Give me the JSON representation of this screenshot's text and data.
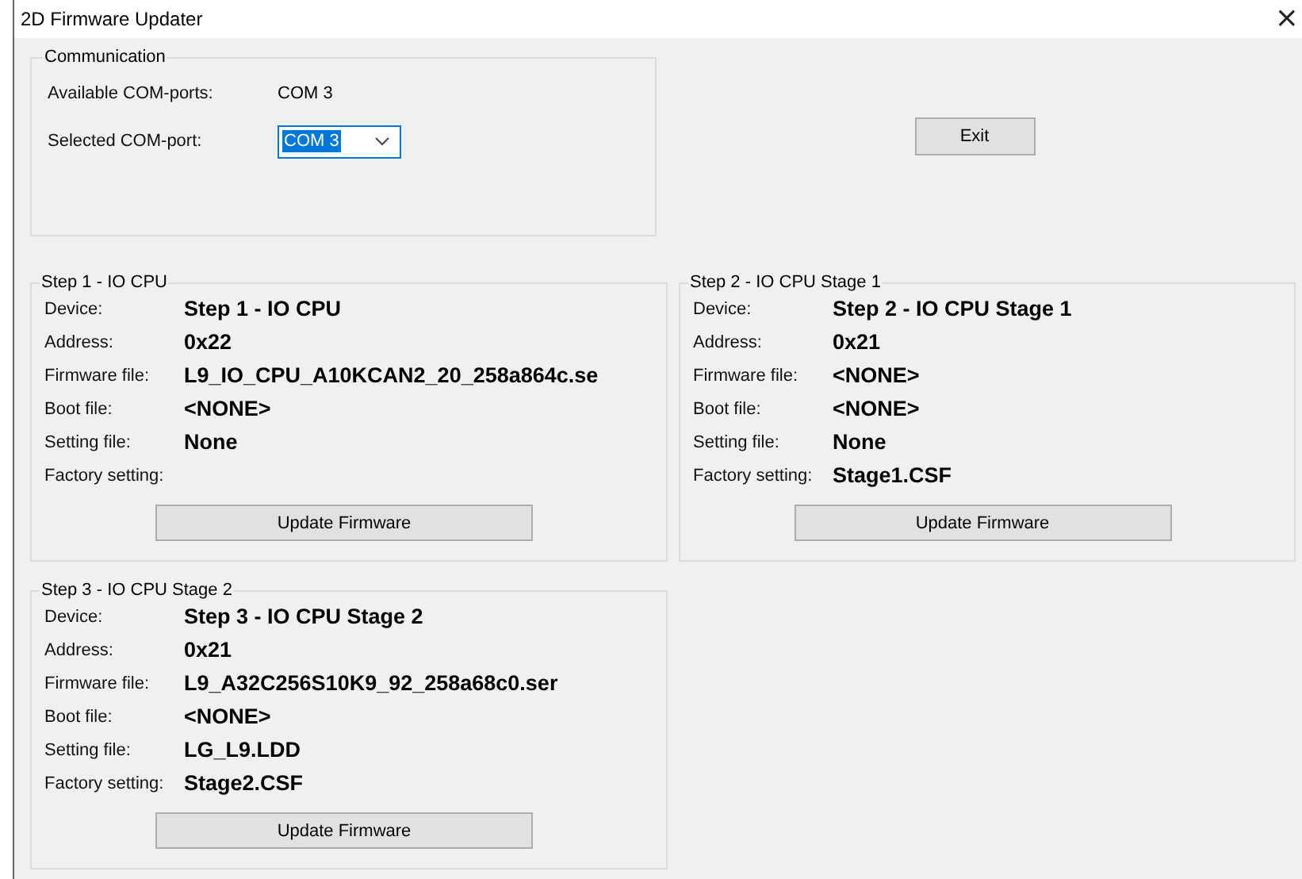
{
  "window": {
    "title": "2D Firmware Updater",
    "close": "×"
  },
  "communication": {
    "title": "Communication",
    "available_label": "Available COM-ports:",
    "available_value": "COM 3",
    "selected_label": "Selected COM-port:",
    "selected_value": "COM 3",
    "selected_text_highlighted": true
  },
  "exit_button": "Exit",
  "steps": [
    {
      "title": "Step 1 - IO CPU",
      "fields": [
        {
          "label": "Device:",
          "value": "Step 1 - IO CPU"
        },
        {
          "label": "Address:",
          "value": "0x22"
        },
        {
          "label": "Firmware file:",
          "value": "L9_IO_CPU_A10KCAN2_20_258a864c.se"
        },
        {
          "label": "Boot file:",
          "value": "<NONE>"
        },
        {
          "label": "Setting file:",
          "value": "None"
        },
        {
          "label": "Factory setting:"
        }
      ],
      "button": "Update Firmware"
    },
    {
      "title": "Step 2 - IO CPU Stage 1",
      "fields": [
        {
          "label": "Device:",
          "value": "Step 2 - IO CPU Stage 1"
        },
        {
          "label": "Address:",
          "value": "0x21"
        },
        {
          "label": "Firmware file:",
          "value": "<NONE>"
        },
        {
          "label": "Boot file:",
          "value": "<NONE>"
        },
        {
          "label": "Setting file:",
          "value": "None"
        },
        {
          "label": "Factory setting:",
          "value": "Stage1.CSF"
        }
      ],
      "button": "Update Firmware"
    },
    {
      "title": "Step 3 - IO CPU Stage 2",
      "fields": [
        {
          "label": "Device:",
          "value": "Step 3 - IO CPU Stage 2"
        },
        {
          "label": "Address:",
          "value": "0x21"
        },
        {
          "label": "Firmware file:",
          "value": "L9_A32C256S10K9_92_258a68c0.ser"
        },
        {
          "label": "Boot file:",
          "value": "<NONE>"
        },
        {
          "label": "Setting file:",
          "value": "LG_L9.LDD"
        },
        {
          "label": "Factory setting:",
          "value": "Stage2.CSF"
        }
      ],
      "button": "Update Firmware"
    }
  ]
}
